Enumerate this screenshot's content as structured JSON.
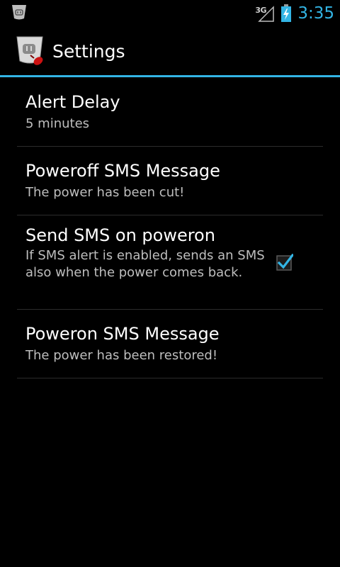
{
  "status_bar": {
    "network": "3G",
    "time": "3:35",
    "clock_color": "#33b5e5",
    "icons": [
      "notification-plug-icon",
      "signal-3g-icon",
      "battery-charging-icon"
    ]
  },
  "action_bar": {
    "title": "Settings",
    "icon": "app-plug-icon",
    "accent_color": "#33b5e5"
  },
  "preferences": [
    {
      "title": "Alert Delay",
      "summary": "5 minutes"
    },
    {
      "title": "Poweroff SMS Message",
      "summary": "The power has been cut!"
    },
    {
      "title": "Send SMS on poweron",
      "summary": "If SMS alert is enabled, sends an SMS also when the power comes back.",
      "checked": true
    },
    {
      "title": "Poweron SMS Message",
      "summary": "The power has been restored!"
    }
  ]
}
